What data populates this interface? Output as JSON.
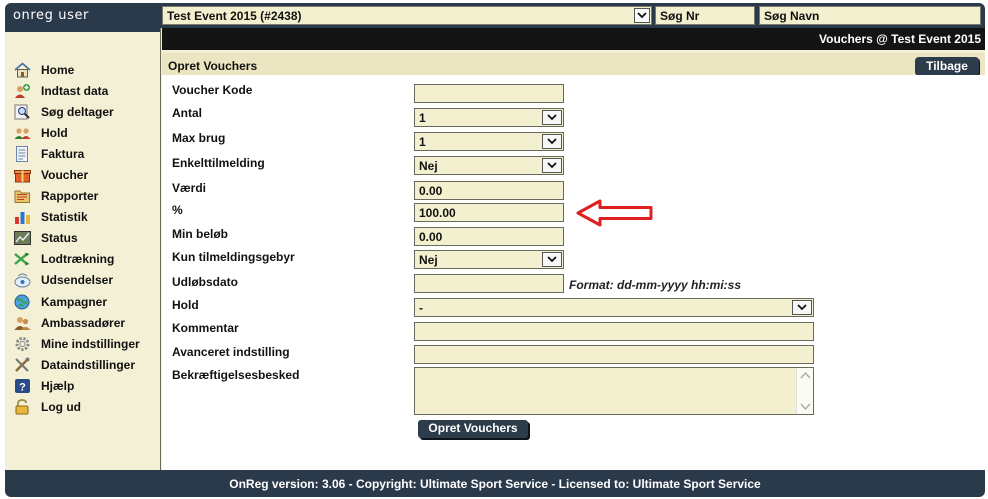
{
  "brand": "onreg user",
  "event_select": "Test Event 2015 (#2438)",
  "search": {
    "nr_label": "Søg Nr",
    "name_label": "Søg Navn"
  },
  "strip_title": "Vouchers @ Test Event 2015",
  "sidebar": {
    "items": [
      {
        "label": "Home",
        "icon": "home-icon"
      },
      {
        "label": "Indtast data",
        "icon": "add-user-icon"
      },
      {
        "label": "Søg deltager",
        "icon": "search-icon"
      },
      {
        "label": "Hold",
        "icon": "team-icon"
      },
      {
        "label": "Faktura",
        "icon": "invoice-icon"
      },
      {
        "label": "Voucher",
        "icon": "gift-icon"
      },
      {
        "label": "Rapporter",
        "icon": "folder-icon"
      },
      {
        "label": "Statistik",
        "icon": "bar-chart-icon"
      },
      {
        "label": "Status",
        "icon": "status-chart-icon"
      },
      {
        "label": "Lodtrækning",
        "icon": "shuffle-icon"
      },
      {
        "label": "Udsendelser",
        "icon": "broadcast-icon"
      },
      {
        "label": "Kampagner",
        "icon": "globe-icon"
      },
      {
        "label": "Ambassadører",
        "icon": "people-icon"
      },
      {
        "label": "Mine indstillinger",
        "icon": "gear-icon"
      },
      {
        "label": "Dataindstillinger",
        "icon": "tools-icon"
      },
      {
        "label": "Hjælp",
        "icon": "help-icon"
      },
      {
        "label": "Log ud",
        "icon": "lock-icon"
      }
    ]
  },
  "panel": {
    "title": "Opret Vouchers",
    "back_label": "Tilbage"
  },
  "form": {
    "labels": {
      "code": "Voucher Kode",
      "antal": "Antal",
      "max": "Max brug",
      "single": "Enkelttilmelding",
      "value": "Værdi",
      "pct": "%",
      "min": "Min beløb",
      "fee": "Kun tilmeldingsgebyr",
      "expiry": "Udløbsdato",
      "team": "Hold",
      "comment": "Kommentar",
      "advanced": "Avanceret indstilling",
      "confirm": "Bekræftigelsesbesked"
    },
    "values": {
      "code": "",
      "antal": "1",
      "max": "1",
      "single": "Nej",
      "value": "0.00",
      "pct": "100.00",
      "min": "0.00",
      "fee": "Nej",
      "expiry": "",
      "team": "-",
      "comment": "",
      "advanced": "",
      "confirm": ""
    },
    "expiry_hint": "Format: dd-mm-yyyy hh:mi:ss",
    "submit_label": "Opret Vouchers"
  },
  "annotation": {
    "color": "#e02020"
  },
  "footer": "OnReg version: 3.06 - Copyright: Ultimate Sport Service - Licensed to: Ultimate Sport Service"
}
